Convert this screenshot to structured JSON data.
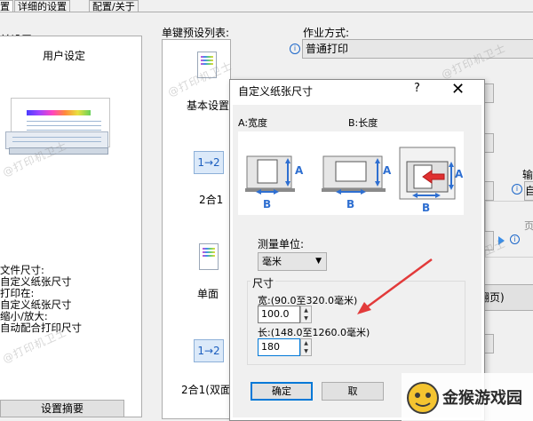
{
  "tabs": [
    "置",
    "详细的设置",
    "配置/关于"
  ],
  "left": {
    "heading": "前设置",
    "user_setting": "用户设定",
    "info_lines": [
      "文件尺寸:",
      "自定义纸张尺寸",
      "打印在:",
      "自定义纸张尺寸",
      "缩小/放大:",
      "自动配合打印尺寸"
    ],
    "summary_button": "设置摘要"
  },
  "presets": {
    "label": "单键预设列表:",
    "items": [
      "基本设置",
      "2合1",
      "单面",
      "2合1(双面"
    ],
    "nup_icon_text": "1→2"
  },
  "right": {
    "job_label": "作业方式:",
    "job_value": "普通打印",
    "fragments": [
      "输",
      "自",
      "页",
      "翻页)"
    ]
  },
  "dialog": {
    "title": "自定义纸张尺寸",
    "help": "?",
    "close": "✕",
    "a_label": "A:宽度",
    "b_label": "B:长度",
    "letter_a": "A",
    "letter_b": "B",
    "unit_label": "测量单位:",
    "unit_value": "毫米",
    "size_group": "尺寸",
    "width_label": "宽:(90.0至320.0毫米)",
    "width_value": "100.0",
    "length_label": "长:(148.0至1260.0毫米)",
    "length_value": "180",
    "ok": "确定",
    "cancel": "取"
  },
  "watermark": "@打印机卫士",
  "logo_text": "金猴游戏园",
  "colors": {
    "accent": "#0078d7",
    "arrow": "#e23a3a",
    "dialog_border": "#8a8a8a"
  }
}
